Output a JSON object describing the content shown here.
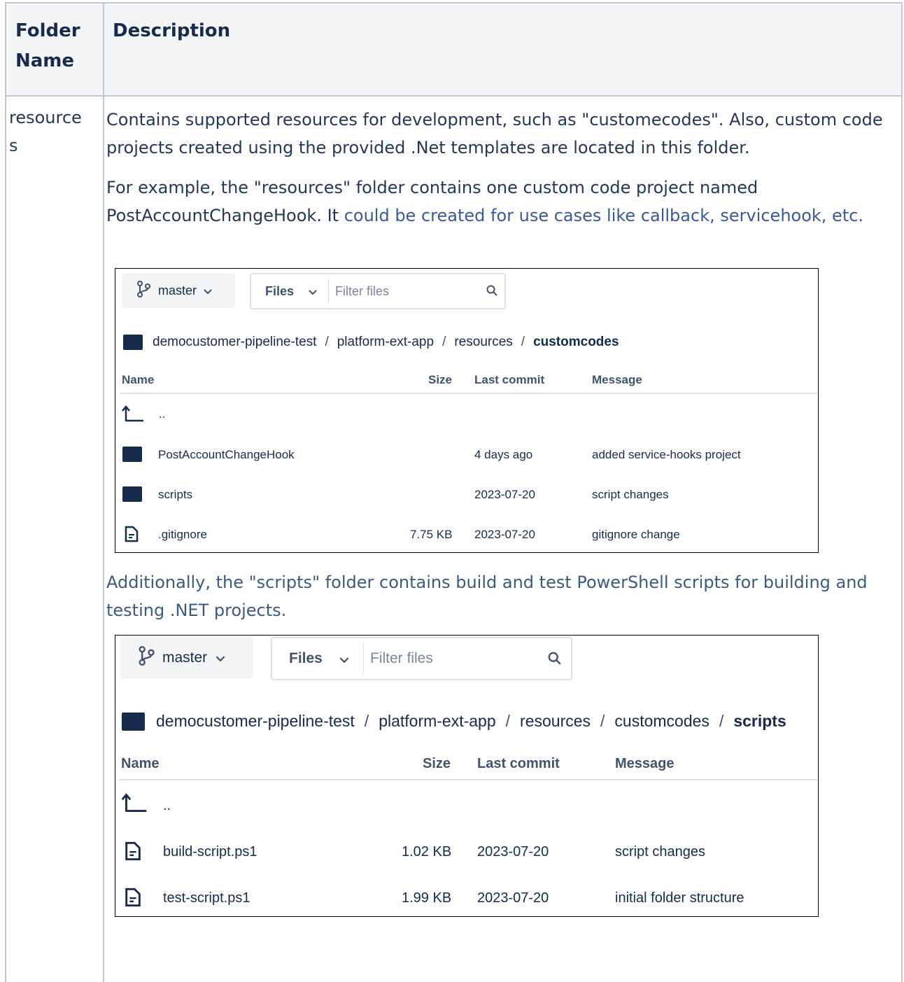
{
  "table": {
    "header_folder": "Folder Name",
    "header_description": "Description",
    "folder_name": "resources",
    "para1": "Contains supported resources for development, such as \"customecodes\". Also, custom code projects created using the provided .Net templates are located in this folder.",
    "para2_plain": "For example, the \"resources\" folder contains one custom code project named PostAccountChangeHook. It ",
    "para2_link": "could be created for use cases like callback, servicehook, etc.",
    "para3": "Additionally, the \"scripts\" folder contains build and test PowerShell scripts for building and testing .NET projects."
  },
  "shot1": {
    "branch": "master",
    "files_label": "Files",
    "filter_placeholder": "Filter files",
    "breadcrumbs": [
      "democustomer-pipeline-test",
      "platform-ext-app",
      "resources"
    ],
    "breadcrumb_current": "customcodes",
    "columns": {
      "name": "Name",
      "size": "Size",
      "last_commit": "Last commit",
      "message": "Message"
    },
    "parent_link": "..",
    "rows": [
      {
        "type": "folder",
        "name": "PostAccountChangeHook",
        "size": "",
        "last_commit": "4 days ago",
        "message": "added service-hooks project"
      },
      {
        "type": "folder",
        "name": "scripts",
        "size": "",
        "last_commit": "2023-07-20",
        "message": "script changes"
      },
      {
        "type": "file",
        "name": ".gitignore",
        "size": "7.75 KB",
        "last_commit": "2023-07-20",
        "message": "gitignore change"
      }
    ]
  },
  "shot2": {
    "branch": "master",
    "files_label": "Files",
    "filter_placeholder": "Filter files",
    "breadcrumbs": [
      "democustomer-pipeline-test",
      "platform-ext-app",
      "resources",
      "customcodes"
    ],
    "breadcrumb_current": "scripts",
    "columns": {
      "name": "Name",
      "size": "Size",
      "last_commit": "Last commit",
      "message": "Message"
    },
    "parent_link": "..",
    "rows": [
      {
        "type": "file",
        "name": "build-script.ps1",
        "size": "1.02 KB",
        "last_commit": "2023-07-20",
        "message": "script changes"
      },
      {
        "type": "file",
        "name": "test-script.ps1",
        "size": "1.99 KB",
        "last_commit": "2023-07-20",
        "message": "initial folder structure"
      }
    ]
  },
  "colors": {
    "table_border": "#c1c7d0",
    "header_bg": "#f4f5f7",
    "text": "#253858",
    "link": "#3b5998",
    "icon": "#172b4d"
  }
}
